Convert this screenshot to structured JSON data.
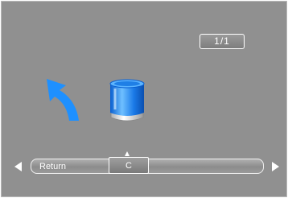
{
  "pager": {
    "text": "1/1"
  },
  "icons": {
    "back": "back-arrow-icon",
    "storage": "storage-drive-icon"
  },
  "menu": {
    "items": [
      {
        "label": "Return"
      },
      {
        "label": "C",
        "selected": true
      }
    ]
  },
  "colors": {
    "background": "#909090",
    "accent": "#1e90ff"
  }
}
